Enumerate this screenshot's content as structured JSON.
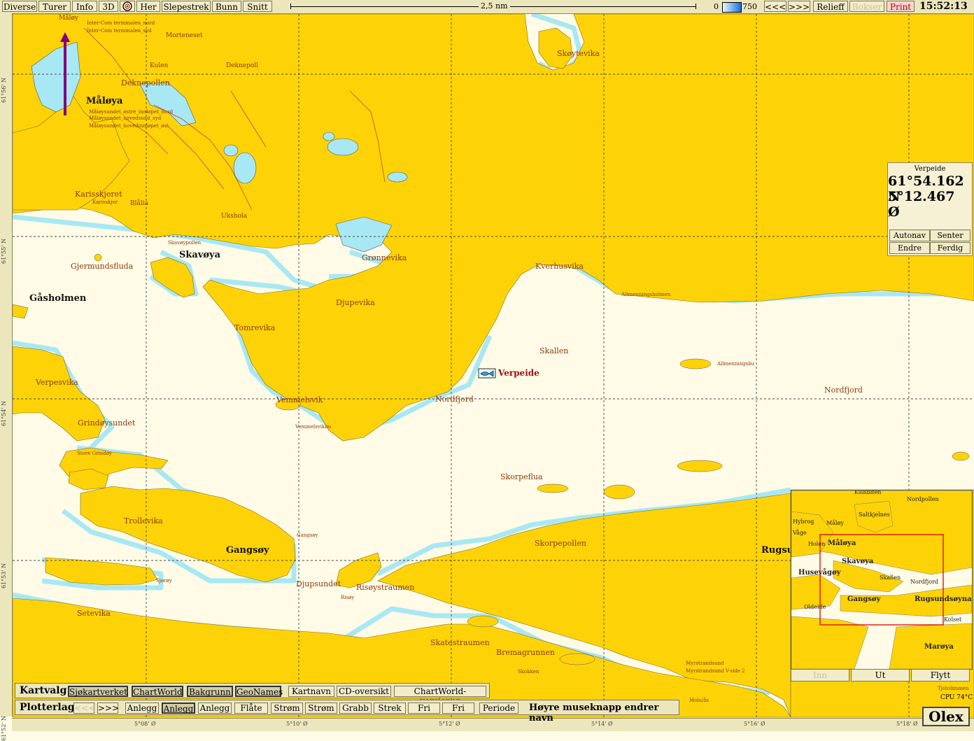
{
  "toolbar": {
    "diverse": "Diverse",
    "turer": "Turer",
    "info": "Info",
    "three_d": "3D",
    "her": "Her",
    "slepestrek": "Slepestrek",
    "bunn": "Bunn",
    "snitt": "Snitt",
    "scale": "2,5 nm",
    "depth_min": "0",
    "depth_max": "750",
    "back": "<<<",
    "forward": ">>>",
    "relieff": "Relieff",
    "bokser": "Bokser",
    "print": "Print",
    "clock": "15:52:13"
  },
  "colors": {
    "land": "#fdd308",
    "water": "#fffbe6",
    "shallow": "#a8e8f4",
    "grid": "#444444",
    "track": "#800080"
  },
  "icons": {
    "her": "compass-target-icon",
    "vessel": "fish-vessel-icon"
  },
  "grid": {
    "lat_labels": [
      "61°56' N",
      "61°55' N",
      "61°54' N",
      "61°53' N",
      "61°52' N"
    ],
    "lon_labels": [
      "5°08' Ø",
      "5°10' Ø",
      "5°12' Ø",
      "5°14' Ø",
      "5°16' Ø",
      "5°18' Ø"
    ]
  },
  "map": {
    "labels": {
      "maloy_top": "Måløy",
      "intercom_nord": "Inter-Com terminalen_nord",
      "intercom_syd": "Inter-Com terminalen_syd",
      "morteneset": "Morteneset",
      "kulen": "Kulen",
      "deknepoll": "Deknepoll",
      "deknepollen": "Deknepollen",
      "maloya": "Måløya",
      "sund1": "Måløysundet_østre_innløpet_nord",
      "sund2": "Måløysundet_hovedsund_syd",
      "sund3": "Måløysundet_hovedinnløpet_øst",
      "skoytevika": "Skøytevika",
      "karisskjeret": "Karisskjeret",
      "karisskjer": "Karisskjer",
      "blalia": "Blålia",
      "uksholа": "Ukshola",
      "skavoya": "Skavøya",
      "skavoy_pt": "Skavøypollen",
      "gronnevika": "Grønnevika",
      "gjermundsfluda": "Gjermundsfluda",
      "gasholmen": "Gåsholmen",
      "djupevika": "Djupevika",
      "kverhusvika": "Kverhusvika",
      "allmenningsholmen": "Allmenningsholmen",
      "tomrevika": "Tomrevika",
      "skallen": "Skallen",
      "verpeide_vessel": "Verpeide",
      "allmenningsbu": "Allmenningsbu",
      "nordfjord_mid": "Nordfjord",
      "nordfjord_east": "Nordfjord",
      "verpesvika": "Verpesvika",
      "vemmelsvik": "Vemmelsvik",
      "vemmelsvikbu": "Vemmelsvikbu",
      "grindoysundet": "Grindøysundet",
      "store_grindoy": "Store Grindøy",
      "skorpeflua": "Skorpeflua",
      "trollevika": "Trollevika",
      "gangsoy": "Gangsøy",
      "gangsoy_pt": "Gangsøy",
      "skorpepollen": "Skorpepollen",
      "rugsund": "Rugsu",
      "djupsundet": "Djupsundet",
      "risoystraumen": "Risøystraumen",
      "risoy": "Risøy",
      "sjoroy": "Sjørøy",
      "setevika": "Setevika",
      "skatestraumen": "Skatestraumen",
      "bremagrunnen": "Bremagrunnen",
      "skokken": "Skokken",
      "myrsund": "Myrstrandsund",
      "myrsund2": "Myrstrandsund V-side 2",
      "molo": "Molo/ås",
      "tjotoli": "Tjotolimmen"
    }
  },
  "position": {
    "title": "Verpeide",
    "lat": "61°54.162 N",
    "lon": "5°12.467 Ø",
    "btn_autonav": "Autonav",
    "btn_senter": "Senter",
    "btn_endre": "Endre",
    "btn_ferdig": "Ferdig"
  },
  "overview": {
    "labels": {
      "kulsbiten": "Kulsbiten",
      "hybrog": "Hybrog",
      "maloy": "Måløy",
      "vage": "Våge",
      "holen": "Holen",
      "maloya": "Måløya",
      "skavoya": "Skavøya",
      "husevagoy": "Husevågøy",
      "gangsoy": "Gangsøy",
      "rugsundsoyna": "Rugsundsøyna",
      "oldeide": "Oldeide",
      "kolset": "Kolset",
      "maroya": "Marøya",
      "nordpollen": "Nordpollen",
      "saltkjelnes": "Saltkjelnes",
      "skallen": "Skallen",
      "nordfjord": "Nordfjord"
    },
    "btn_inn": "Inn",
    "btn_ut": "Ut",
    "btn_flytt": "Flytt",
    "cpu": "CPU 74°C",
    "logo": "Olex"
  },
  "kartvalg": {
    "title": "Kartvalg",
    "items": [
      "Sjøkartverket",
      "ChartWorld",
      "Bakgrunn",
      "GeoNames",
      "Kartnavn",
      "CD-oversikt",
      "ChartWorld-versjoner"
    ]
  },
  "plotterlag": {
    "title": "Plotterlag",
    "items": [
      "<<<",
      ">>>",
      "Anlegg",
      "Anlegg",
      "Anlegg",
      "Flåte",
      "Strøm",
      "Strøm",
      "Grabb",
      "Strek",
      "Fri",
      "Fri",
      "Periode"
    ],
    "hint": "Høyre museknapp endrer navn"
  }
}
